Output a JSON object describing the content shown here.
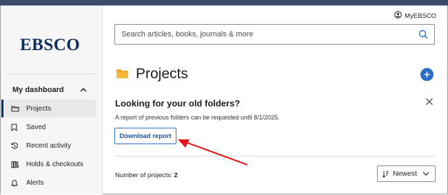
{
  "brand": {
    "logo_text": "EBSCO",
    "accent": "#2c6fc3",
    "logo_color": "#0d2d5e",
    "annotation_arrow_color": "#e3161b"
  },
  "header": {
    "account_label": "MyEBSCO"
  },
  "search": {
    "placeholder": "Search articles, books, journals & more"
  },
  "sidebar": {
    "section_label": "My dashboard",
    "items": [
      {
        "label": "Projects",
        "icon": "folder-icon",
        "active": true
      },
      {
        "label": "Saved",
        "icon": "bookmark-icon",
        "active": false
      },
      {
        "label": "Recent activity",
        "icon": "history-icon",
        "active": false
      },
      {
        "label": "Holds & checkouts",
        "icon": "books-icon",
        "active": false
      },
      {
        "label": "Alerts",
        "icon": "bell-icon",
        "active": false
      }
    ]
  },
  "main": {
    "title": "Projects",
    "notice": {
      "title": "Looking for your old folders?",
      "text": "A report of previous folders can be requested until 8/1/2025.",
      "button_label": "Download report"
    },
    "count_label": "Number of projects:",
    "count_value": "2",
    "sort_label": "Newest"
  }
}
